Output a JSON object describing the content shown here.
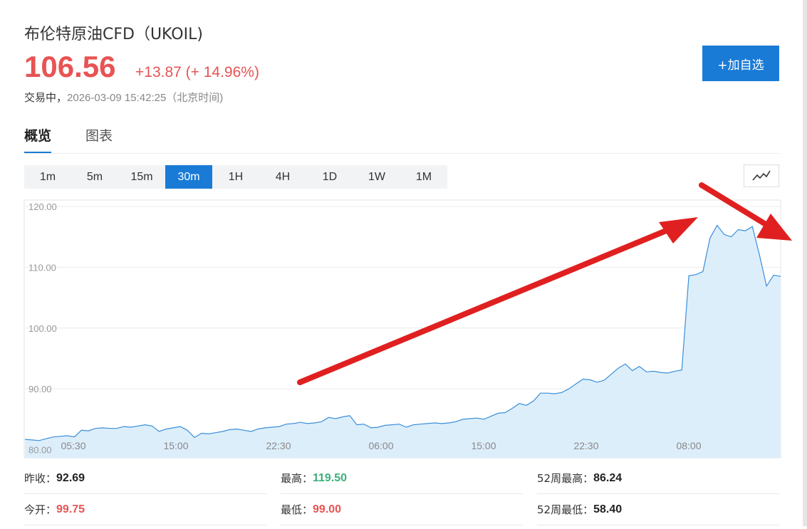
{
  "header": {
    "title": "布伦特原油CFD（UKOIL)",
    "price": "106.56",
    "change": "+13.87 (+ 14.96%)",
    "status": "交易中，",
    "timestamp": "2026-03-09 15:42:25（北京时间)",
    "add_button": "+加自选"
  },
  "tabs": [
    {
      "label": "概览",
      "active": true
    },
    {
      "label": "图表",
      "active": false
    }
  ],
  "intervals": [
    {
      "label": "1m",
      "active": false
    },
    {
      "label": "5m",
      "active": false
    },
    {
      "label": "15m",
      "active": false
    },
    {
      "label": "30m",
      "active": true
    },
    {
      "label": "1H",
      "active": false
    },
    {
      "label": "4H",
      "active": false
    },
    {
      "label": "1D",
      "active": false
    },
    {
      "label": "1W",
      "active": false
    },
    {
      "label": "1M",
      "active": false
    }
  ],
  "chart_type_icon": "line-chart-icon",
  "colors": {
    "up": "#e85353",
    "accent": "#1a7bd6",
    "high_value": "#3bb07a",
    "line": "#3a8fd9",
    "fill": "#ddeefb",
    "arrow": "#e02020"
  },
  "chart_data": {
    "type": "area",
    "xlabel": "",
    "ylabel": "",
    "ylim": [
      80,
      120
    ],
    "y_ticks": [
      "120.00",
      "110.00",
      "100.00",
      "90.00",
      "80.00"
    ],
    "x_ticks": [
      "05:30",
      "15:00",
      "22:30",
      "06:00",
      "15:00",
      "22:30",
      "08:00"
    ],
    "grid": true,
    "series": [
      {
        "values": [
          81.7,
          81.6,
          81.5,
          81.8,
          82.1,
          82.2,
          82.3,
          82.1,
          83.2,
          83.1,
          83.5,
          83.6,
          83.5,
          83.5,
          83.8,
          83.7,
          83.9,
          84.1,
          83.9,
          83.0,
          83.4,
          83.6,
          83.8,
          83.2,
          82.0,
          82.7,
          82.6,
          82.8,
          83.0,
          83.3,
          83.4,
          83.2,
          83.0,
          83.4,
          83.6,
          83.7,
          83.8,
          84.2,
          84.3,
          84.5,
          84.3,
          84.4,
          84.6,
          85.3,
          85.1,
          85.4,
          85.6,
          84.1,
          84.2,
          83.6,
          83.7,
          84.0,
          84.1,
          84.2,
          83.7,
          84.1,
          84.2,
          84.3,
          84.4,
          84.3,
          84.4,
          84.6,
          85.0,
          85.1,
          85.2,
          85.0,
          85.5,
          86.0,
          86.1,
          86.8,
          87.6,
          87.3,
          88.0,
          89.3,
          89.3,
          89.2,
          89.4,
          90.0,
          90.8,
          91.6,
          91.5,
          91.1,
          91.4,
          92.4,
          93.4,
          94.1,
          93.0,
          93.7,
          92.8,
          92.9,
          92.7,
          92.6,
          92.9,
          93.1,
          108.6,
          108.8,
          109.3,
          114.8,
          116.9,
          115.4,
          115.0,
          116.2,
          116.0,
          116.7,
          112.0,
          106.9,
          108.7,
          108.5
        ]
      }
    ]
  },
  "stats": [
    {
      "label": "昨收：",
      "value": "92.69",
      "color": "#222222"
    },
    {
      "label": "最高：",
      "value": "119.50",
      "color": "#3bb07a"
    },
    {
      "label": "52周最高：",
      "value": "86.24",
      "color": "#222222"
    },
    {
      "label": "今开：",
      "value": "99.75",
      "color": "#e85353"
    },
    {
      "label": "最低：",
      "value": "99.00",
      "color": "#e85353"
    },
    {
      "label": "52周最低：",
      "value": "58.40",
      "color": "#222222"
    }
  ]
}
